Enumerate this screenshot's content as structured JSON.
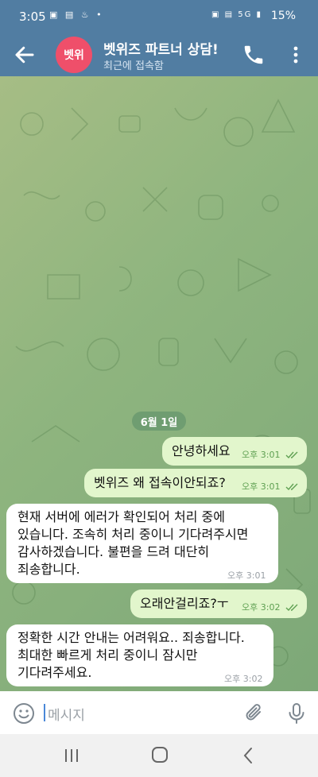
{
  "status_bar": {
    "time": "3:05",
    "left_icons": "▣ ▤ ♨ •",
    "right_icons": "▣ ▤ 5G ▮",
    "battery": "15%"
  },
  "header": {
    "avatar_text": "벳위",
    "title": "벳위즈 파트너 상담!",
    "subtitle": "최근에 접속함"
  },
  "chat": {
    "date": "6월 1일",
    "messages": [
      {
        "direction": "out",
        "text": "안녕하세요",
        "time": "오후 3:01"
      },
      {
        "direction": "out",
        "text": "벳위즈 왜 접속이안되죠?",
        "time": "오후 3:01"
      },
      {
        "direction": "in",
        "lines": [
          "현재 서버에 에러가 확인되어 처리 중에",
          "있습니다. 조속히 처리 중이니 기다려주시면",
          "감사하겠습니다. 불편을 드려 대단히",
          "죄송합니다."
        ],
        "time": "오후 3:01"
      },
      {
        "direction": "out",
        "text": "오래안걸리죠?ㅜ",
        "time": "오후 3:02"
      },
      {
        "direction": "in",
        "lines": [
          "정확한 시간 안내는 어려워요.. 죄송합니다.",
          "최대한 빠르게 처리 중이니 잠시만",
          "기다려주세요."
        ],
        "time": "오후 3:02"
      }
    ]
  },
  "composer": {
    "placeholder": "메시지"
  },
  "colors": {
    "header": "#517da2",
    "outgoing_bubble": "#e2f6cc",
    "incoming_bubble": "#ffffff",
    "accent": "#5fa052"
  }
}
